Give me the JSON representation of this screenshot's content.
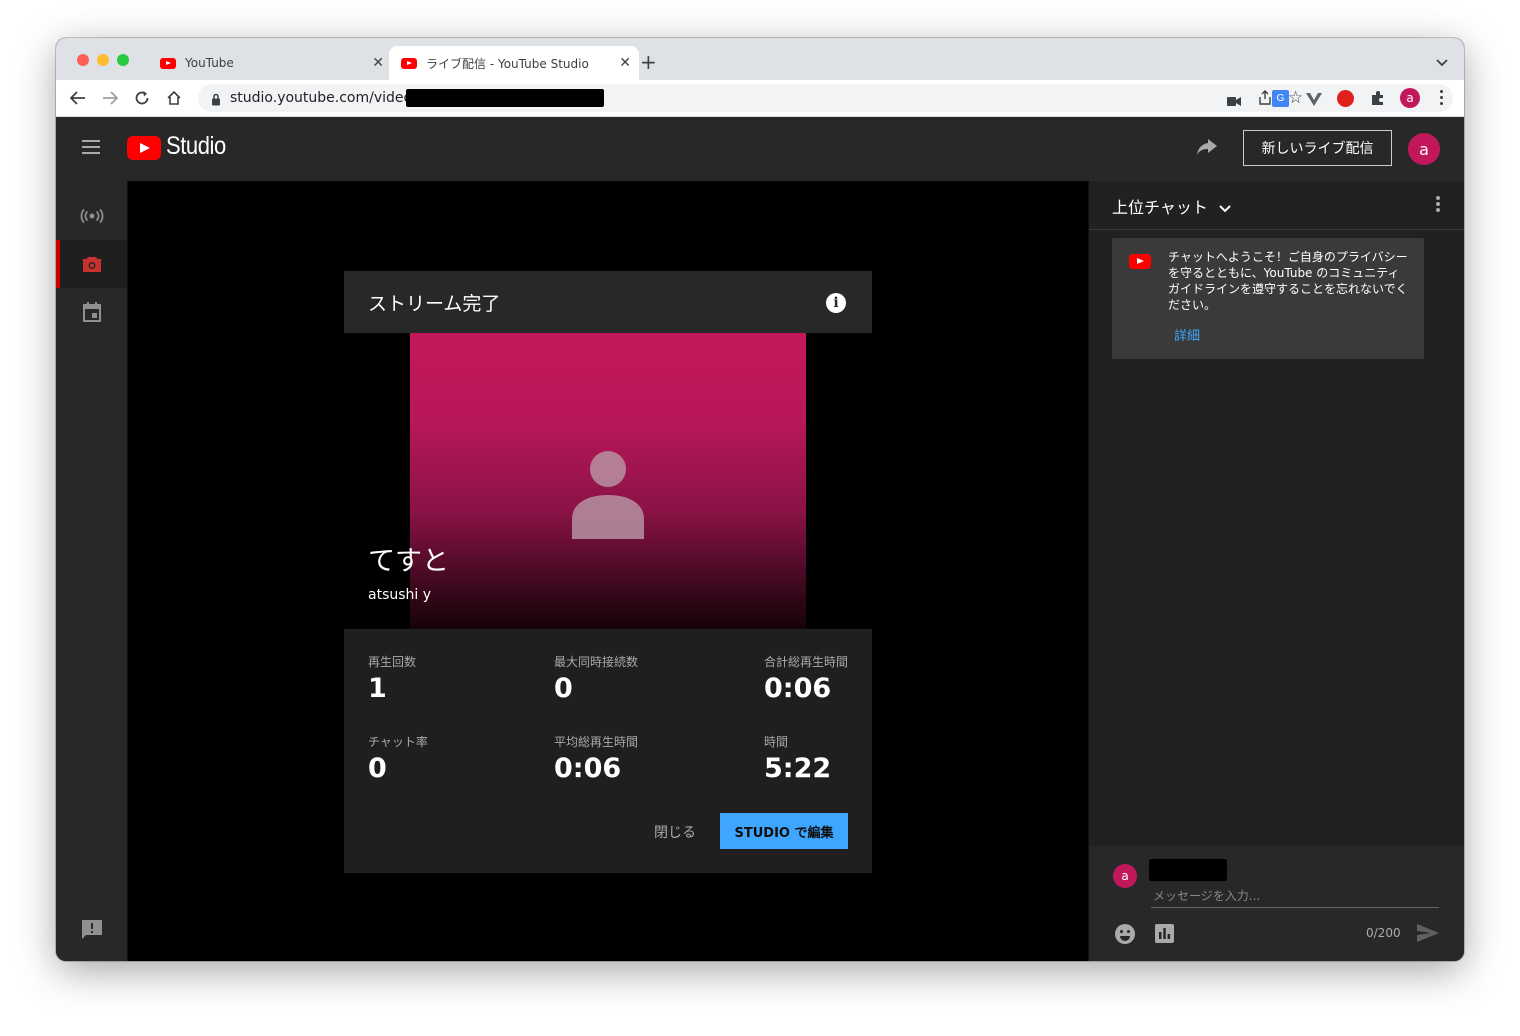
{
  "browser": {
    "tabs": [
      {
        "title": "YouTube"
      },
      {
        "title": "ライブ配信 - YouTube Studio"
      }
    ],
    "url": "studio.youtube.com/video/"
  },
  "header": {
    "logo_text": "Studio",
    "new_live_label": "新しいライブ配信",
    "avatar_letter": "a"
  },
  "card": {
    "title": "ストリーム完了",
    "stream_title": "てすと",
    "author": "atsushi y",
    "stats": [
      {
        "label": "再生回数",
        "value": "1"
      },
      {
        "label": "最大同時接続数",
        "value": "0"
      },
      {
        "label": "合計総再生時間",
        "value": "0:06"
      },
      {
        "label": "チャット率",
        "value": "0"
      },
      {
        "label": "平均総再生時間",
        "value": "0:06"
      },
      {
        "label": "時間",
        "value": "5:22"
      }
    ],
    "close_label": "閉じる",
    "edit_label": "STUDIO で編集"
  },
  "chat": {
    "title": "上位チャット",
    "welcome": "チャットへようこそ！ご自身のプライバシーを守るとともに、YouTube のコミュニティ ガイドラインを遵守することを忘れないでください。",
    "welcome_link": "詳細",
    "avatar_letter": "a",
    "placeholder": "メッセージを入力...",
    "counter": "0/200"
  },
  "colors": {
    "accent_blue": "#3ea6ff",
    "brand_red": "#ff0000",
    "avatar_pink": "#c2185b"
  }
}
